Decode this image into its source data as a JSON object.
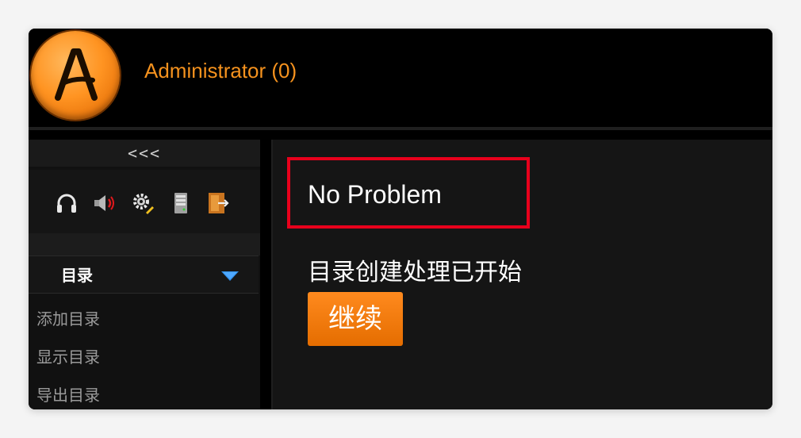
{
  "header": {
    "logo_letter": "A",
    "user_label": "Administrator (0)"
  },
  "sidebar": {
    "collapse_label": "<<<",
    "toolbar_icons": [
      "headphones-icon",
      "speaker-icon",
      "gear-icon",
      "server-icon",
      "exit-door-icon"
    ],
    "menu": {
      "title": "目录",
      "items": [
        "添加目录",
        "显示目录",
        "导出目录"
      ]
    }
  },
  "main": {
    "title": "No Problem",
    "status": "目录创建处理已开始",
    "continue_label": "继续"
  },
  "colors": {
    "accent": "#f5921e",
    "highlight_box": "#e8001c",
    "button": "#ff8a1e"
  }
}
